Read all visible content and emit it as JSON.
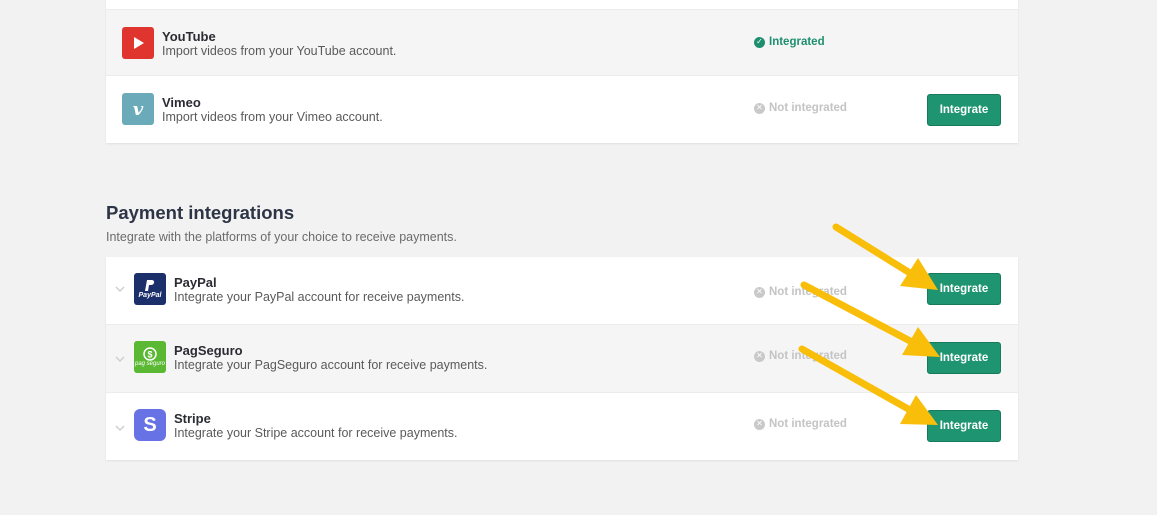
{
  "video_integrations": [
    {
      "name": "YouTube",
      "description": "Import videos from your YouTube account.",
      "status": "Integrated",
      "logo_icon": "play-icon",
      "logo_color": "#e0352e"
    },
    {
      "name": "Vimeo",
      "description": "Import videos from your Vimeo account.",
      "status": "Not integrated",
      "button": "Integrate",
      "logo_icon": "vimeo-icon",
      "logo_color": "#6baab9"
    }
  ],
  "payment_section": {
    "title": "Payment integrations",
    "subtitle": "Integrate with the platforms of your choice to receive payments."
  },
  "payment_integrations": [
    {
      "name": "PayPal",
      "description": "Integrate your PayPal account for receive payments.",
      "status": "Not integrated",
      "button": "Integrate",
      "logo_text": "PayPal",
      "logo_icon": "paypal-logo",
      "logo_color": "#1b2f6b"
    },
    {
      "name": "PagSeguro",
      "description": "Integrate your PagSeguro account for receive payments.",
      "status": "Not integrated",
      "button": "Integrate",
      "logo_text": "pag seguro",
      "logo_icon": "pagseguro-logo",
      "logo_color": "#5ab833"
    },
    {
      "name": "Stripe",
      "description": "Integrate your Stripe account for receive payments.",
      "status": "Not integrated",
      "button": "Integrate",
      "logo_text": "S",
      "logo_icon": "stripe-logo",
      "logo_color": "#6772e5"
    }
  ],
  "colors": {
    "accent_button": "#1f9470",
    "integrated_status": "#1e8f6e",
    "not_integrated_status": "#c4c4c4",
    "annotation_arrow": "#f9be0a"
  }
}
